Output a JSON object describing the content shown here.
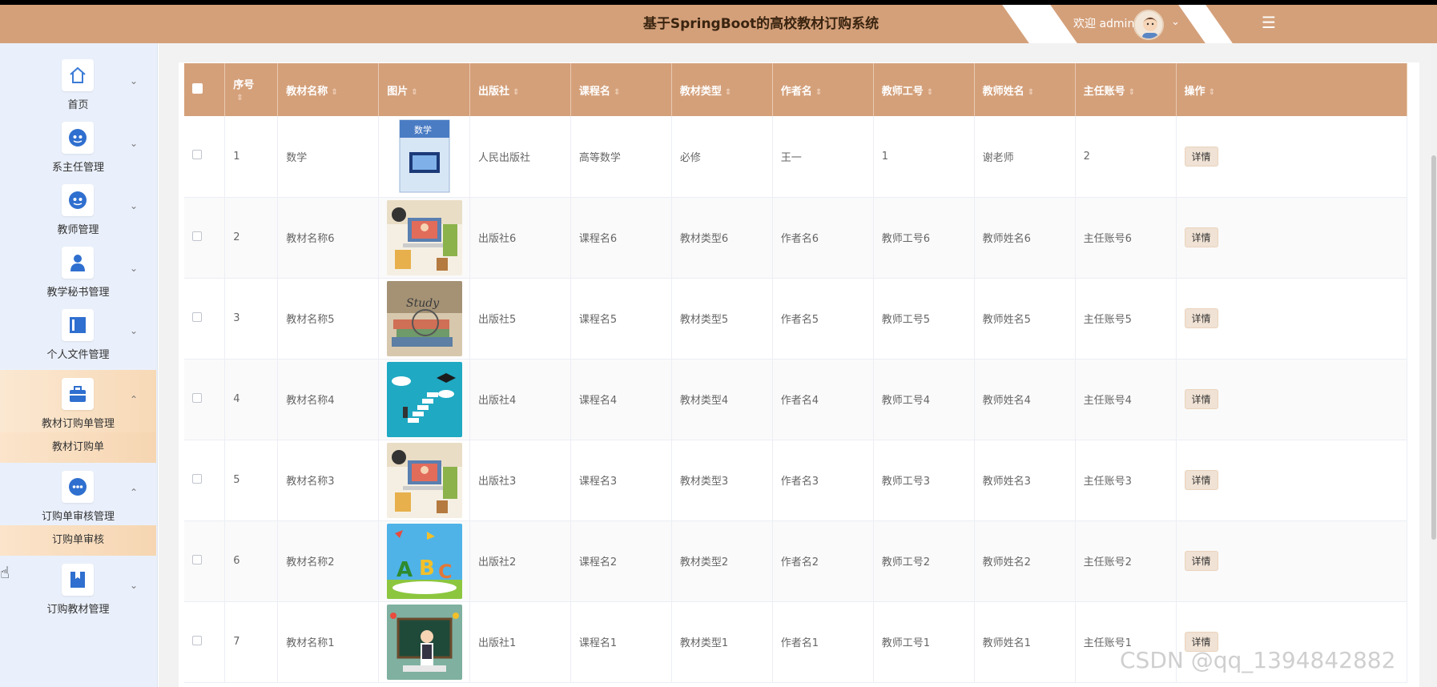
{
  "header": {
    "title": "基于SpringBoot的高校教材订购系统",
    "welcome": "欢迎 admin",
    "avatar_icon": "user-avatar-icon",
    "menu_toggle_icon": "menu-collapse-icon",
    "bg_color": "#d4a07a"
  },
  "sidebar": {
    "items": [
      {
        "label": "首页",
        "icon": "home-icon",
        "expanded": false
      },
      {
        "label": "系主任管理",
        "icon": "user-badge-icon",
        "expanded": false
      },
      {
        "label": "教师管理",
        "icon": "user-badge-icon",
        "expanded": false
      },
      {
        "label": "教学秘书管理",
        "icon": "person-icon",
        "expanded": false
      },
      {
        "label": "个人文件管理",
        "icon": "file-panel-icon",
        "expanded": false
      },
      {
        "label": "教材订购单管理",
        "icon": "briefcase-icon",
        "expanded": true,
        "sub": "教材订购单"
      },
      {
        "label": "订购单审核管理",
        "icon": "dots-circle-icon",
        "expanded": true,
        "sub": "订购单审核"
      },
      {
        "label": "订购教材管理",
        "icon": "bookmark-icon",
        "expanded": false
      }
    ]
  },
  "table": {
    "columns": [
      "序号",
      "教材名称",
      "图片",
      "出版社",
      "课程名",
      "教材类型",
      "作者名",
      "教师工号",
      "教师姓名",
      "主任账号",
      "操作"
    ],
    "rows": [
      {
        "no": "1",
        "name": "数学",
        "image": "math-textbook-cover",
        "publisher": "人民出版社",
        "course": "高等数学",
        "type": "必修",
        "author": "王一",
        "teacher_id": "1",
        "teacher_name": "谢老师",
        "director": "2",
        "action": "详情"
      },
      {
        "no": "2",
        "name": "教材名称6",
        "image": "desk-laptop-illustration",
        "publisher": "出版社6",
        "course": "课程名6",
        "type": "教材类型6",
        "author": "作者名6",
        "teacher_id": "教师工号6",
        "teacher_name": "教师姓名6",
        "director": "主任账号6",
        "action": "详情"
      },
      {
        "no": "3",
        "name": "教材名称5",
        "image": "study-books-photo",
        "publisher": "出版社5",
        "course": "课程名5",
        "type": "教材类型5",
        "author": "作者名5",
        "teacher_id": "教师工号5",
        "teacher_name": "教师姓名5",
        "director": "主任账号5",
        "action": "详情"
      },
      {
        "no": "4",
        "name": "教材名称4",
        "image": "stairs-graduation-illustration",
        "publisher": "出版社4",
        "course": "课程名4",
        "type": "教材类型4",
        "author": "作者名4",
        "teacher_id": "教师工号4",
        "teacher_name": "教师姓名4",
        "director": "主任账号4",
        "action": "详情"
      },
      {
        "no": "5",
        "name": "教材名称3",
        "image": "desk-laptop-illustration",
        "publisher": "出版社3",
        "course": "课程名3",
        "type": "教材类型3",
        "author": "作者名3",
        "teacher_id": "教师工号3",
        "teacher_name": "教师姓名3",
        "director": "主任账号3",
        "action": "详情"
      },
      {
        "no": "6",
        "name": "教材名称2",
        "image": "abc-book-illustration",
        "publisher": "出版社2",
        "course": "课程名2",
        "type": "教材类型2",
        "author": "作者名2",
        "teacher_id": "教师工号2",
        "teacher_name": "教师姓名2",
        "director": "主任账号2",
        "action": "详情"
      },
      {
        "no": "7",
        "name": "教材名称1",
        "image": "teacher-blackboard-illustration",
        "publisher": "出版社1",
        "course": "课程名1",
        "type": "教材类型1",
        "author": "作者名1",
        "teacher_id": "教师工号1",
        "teacher_name": "教师姓名1",
        "director": "主任账号1",
        "action": "详情"
      }
    ]
  },
  "watermark": "CSDN @qq_1394842882"
}
